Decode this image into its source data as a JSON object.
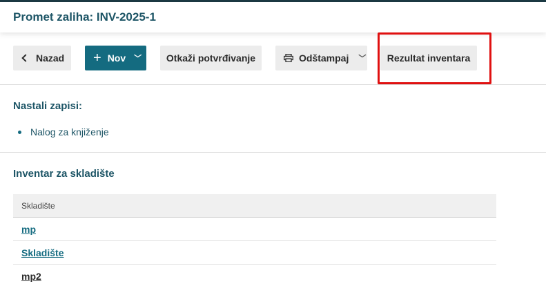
{
  "header": {
    "title": "Promet zaliha: INV-2025-1"
  },
  "toolbar": {
    "back_label": "Nazad",
    "new_label": "Nov",
    "cancel_confirm_label": "Otkaži potvrđivanje",
    "print_label": "Odštampaj",
    "inventory_result_label": "Rezultat inventara"
  },
  "created_records": {
    "title": "Nastali zapisi:",
    "items": [
      "Nalog za knjiženje"
    ]
  },
  "inventory": {
    "title": "Inventar za skladište",
    "column_header": "Skladište",
    "rows": [
      "mp",
      "Skladište",
      "mp2"
    ]
  },
  "colors": {
    "accent": "#146b80",
    "title": "#1d5566",
    "highlight": "#e01010"
  }
}
